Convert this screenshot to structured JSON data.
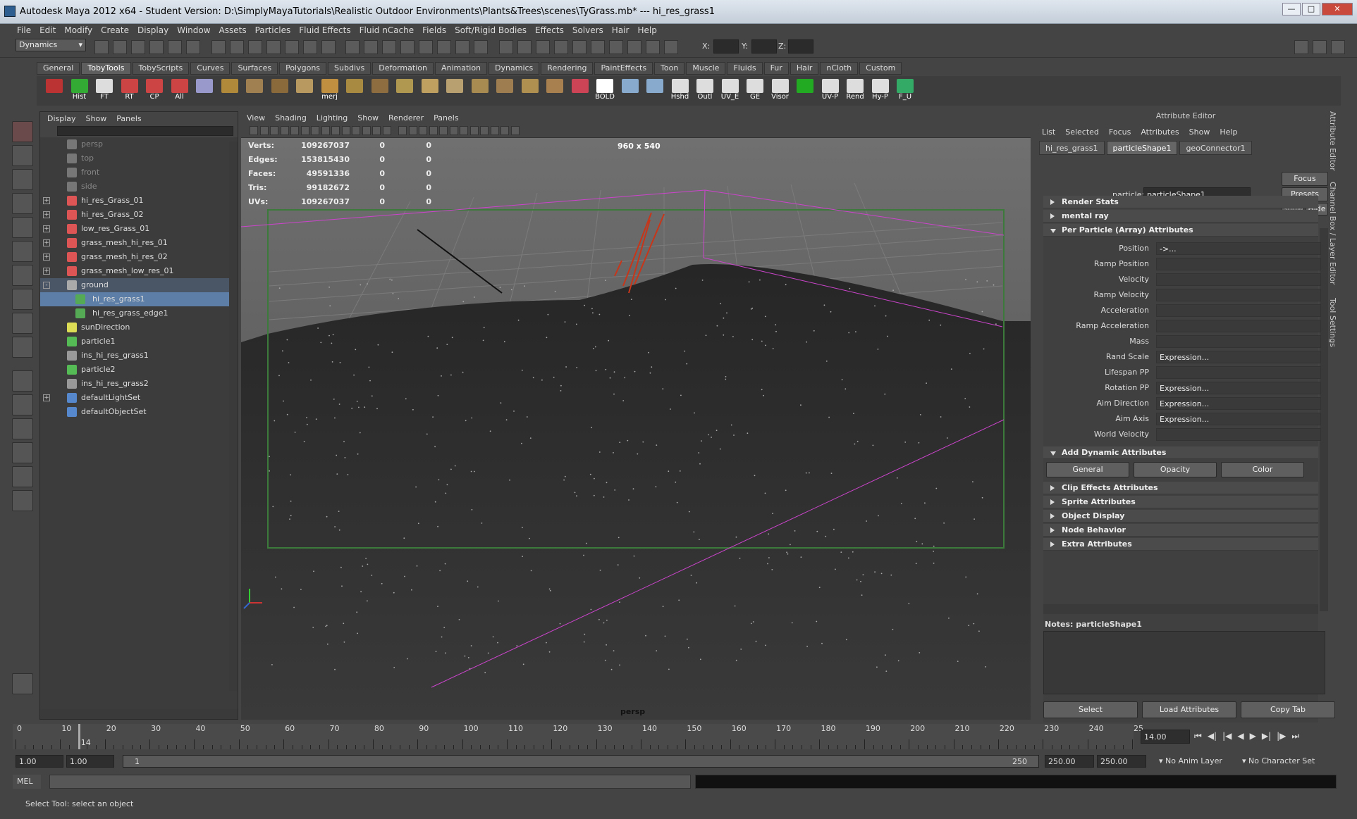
{
  "window": {
    "title": "Autodesk Maya 2012 x64 - Student Version: D:\\SimplyMayaTutorials\\Realistic Outdoor Environments\\Plants&Trees\\scenes\\TyGrass.mb*   ---   hi_res_grass1"
  },
  "menubar": [
    "File",
    "Edit",
    "Modify",
    "Create",
    "Display",
    "Window",
    "Assets",
    "Particles",
    "Fluid Effects",
    "Fluid nCache",
    "Fields",
    "Soft/Rigid Bodies",
    "Effects",
    "Solvers",
    "Hair",
    "Help"
  ],
  "status": {
    "menuset": "Dynamics",
    "x_label": "X:",
    "y_label": "Y:",
    "z_label": "Z:"
  },
  "shelf_tabs": [
    "General",
    "TobyTools",
    "TobyScripts",
    "Curves",
    "Surfaces",
    "Polygons",
    "Subdivs",
    "Deformation",
    "Animation",
    "Dynamics",
    "Rendering",
    "PaintEffects",
    "Toon",
    "Muscle",
    "Fluids",
    "Fur",
    "Hair",
    "nCloth",
    "Custom"
  ],
  "shelf_active": "TobyTools",
  "shelf_icons": [
    "",
    "Hist",
    "FT",
    "RT",
    "CP",
    "All",
    "",
    "",
    "",
    "",
    "",
    "merj",
    "",
    "",
    "",
    "",
    "",
    "",
    "",
    "",
    "",
    "",
    "BOLD",
    "",
    "",
    "Hshd",
    "Outl",
    "UV_E",
    "GE",
    "Visor",
    "",
    "UV-P",
    "Rend",
    "Hy-P",
    "F_U"
  ],
  "outliner": {
    "menu": [
      "Display",
      "Show",
      "Panels"
    ],
    "items": [
      {
        "label": "persp",
        "dim": true,
        "exp": "",
        "level": 0
      },
      {
        "label": "top",
        "dim": true,
        "exp": "",
        "level": 0
      },
      {
        "label": "front",
        "dim": true,
        "exp": "",
        "level": 0
      },
      {
        "label": "side",
        "dim": true,
        "exp": "",
        "level": 0
      },
      {
        "label": "hi_res_Grass_01",
        "exp": "+",
        "level": 0
      },
      {
        "label": "hi_res_Grass_02",
        "exp": "+",
        "level": 0
      },
      {
        "label": "low_res_Grass_01",
        "exp": "+",
        "level": 0
      },
      {
        "label": "grass_mesh_hi_res_01",
        "exp": "+",
        "level": 0
      },
      {
        "label": "grass_mesh_hi_res_02",
        "exp": "+",
        "level": 0
      },
      {
        "label": "grass_mesh_low_res_01",
        "exp": "+",
        "level": 0
      },
      {
        "label": "ground",
        "exp": "-",
        "level": 0,
        "parent": true
      },
      {
        "label": "hi_res_grass1",
        "exp": "",
        "level": 1,
        "sel": true
      },
      {
        "label": "hi_res_grass_edge1",
        "exp": "",
        "level": 1
      },
      {
        "label": "sunDirection",
        "exp": "",
        "level": 0
      },
      {
        "label": "particle1",
        "exp": "",
        "level": 0
      },
      {
        "label": "ins_hi_res_grass1",
        "exp": "",
        "level": 0
      },
      {
        "label": "particle2",
        "exp": "",
        "level": 0
      },
      {
        "label": "ins_hi_res_grass2",
        "exp": "",
        "level": 0
      },
      {
        "label": "defaultLightSet",
        "exp": "+",
        "level": 0
      },
      {
        "label": "defaultObjectSet",
        "exp": "",
        "level": 0
      }
    ]
  },
  "viewport": {
    "menu": [
      "View",
      "Shading",
      "Lighting",
      "Show",
      "Renderer",
      "Panels"
    ],
    "hud": [
      {
        "name": "Verts:",
        "v1": "109267037",
        "v2": "0",
        "v3": "0"
      },
      {
        "name": "Edges:",
        "v1": "153815430",
        "v2": "0",
        "v3": "0"
      },
      {
        "name": "Faces:",
        "v1": "49591336",
        "v2": "0",
        "v3": "0"
      },
      {
        "name": "Tris:",
        "v1": "99182672",
        "v2": "0",
        "v3": "0"
      },
      {
        "name": "UVs:",
        "v1": "109267037",
        "v2": "0",
        "v3": "0"
      }
    ],
    "resolution": "960 x 540",
    "camera": "persp"
  },
  "attr": {
    "title": "Attribute Editor",
    "menu": [
      "List",
      "Selected",
      "Focus",
      "Attributes",
      "Show",
      "Help"
    ],
    "tabs": [
      "hi_res_grass1",
      "particleShape1",
      "geoConnector1"
    ],
    "active_tab": "particleShape1",
    "particle_label": "particle:",
    "particle_value": "particleShape1",
    "focus": "Focus",
    "presets": "Presets",
    "show": "Show",
    "hide": "Hide",
    "sections_top": [
      "Render Stats",
      "mental ray",
      "Per Particle (Array) Attributes"
    ],
    "rows": [
      {
        "label": "Position",
        "value": "->..."
      },
      {
        "label": "Ramp Position",
        "value": ""
      },
      {
        "label": "Velocity",
        "value": ""
      },
      {
        "label": "Ramp Velocity",
        "value": ""
      },
      {
        "label": "Acceleration",
        "value": ""
      },
      {
        "label": "Ramp Acceleration",
        "value": ""
      },
      {
        "label": "Mass",
        "value": ""
      },
      {
        "label": "Rand Scale",
        "value": "Expression..."
      },
      {
        "label": "Lifespan PP",
        "value": ""
      },
      {
        "label": "Rotation PP",
        "value": "Expression..."
      },
      {
        "label": "Aim Direction",
        "value": "Expression..."
      },
      {
        "label": "Aim Axis",
        "value": "Expression..."
      },
      {
        "label": "World Velocity",
        "value": ""
      }
    ],
    "dyn_section": "Add Dynamic Attributes",
    "dyn_buttons": [
      "General",
      "Opacity",
      "Color"
    ],
    "sections_bottom": [
      "Clip Effects Attributes",
      "Sprite Attributes",
      "Object Display",
      "Node Behavior",
      "Extra Attributes"
    ],
    "notes": "Notes:  particleShape1",
    "bottom_buttons": [
      "Select",
      "Load Attributes",
      "Copy Tab"
    ],
    "side_tabs": [
      "Attribute Editor",
      "Channel Box / Layer Editor",
      "Tool Settings"
    ]
  },
  "timeline": {
    "labels": [
      "0",
      "10",
      "20",
      "30",
      "40",
      "50",
      "60",
      "70",
      "80",
      "90",
      "100",
      "110",
      "120",
      "130",
      "140",
      "150",
      "160",
      "170",
      "180",
      "190",
      "200",
      "210",
      "220",
      "230",
      "240",
      "25"
    ],
    "current": "14",
    "current_field": "14.00"
  },
  "range": {
    "start": "1.00",
    "start2": "1.00",
    "slider_start": "1",
    "slider_end": "250",
    "end": "250.00",
    "end2": "250.00",
    "anim_layer": "No Anim Layer",
    "char_set": "No Character Set"
  },
  "cmd": {
    "label": "MEL"
  },
  "help": {
    "text": "Select Tool: select an object"
  },
  "colors": {
    "selection": "#5d7ea6",
    "bg": "#444444",
    "viewport_bg": "#5a5a5a",
    "ground": "#353535",
    "grid_box": "#cc44cc",
    "frame": "#3b7a3b",
    "grass": "#c8361a"
  }
}
